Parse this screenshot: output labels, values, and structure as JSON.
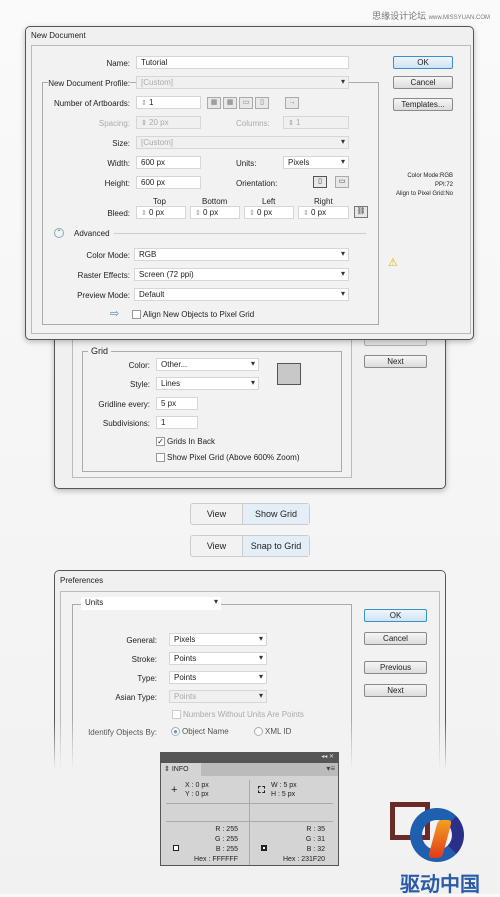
{
  "watermark": {
    "cn": "思缘设计论坛",
    "url": "www.MISSYUAN.COM"
  },
  "new_document": {
    "title": "New Document",
    "name_label": "Name:",
    "name_value": "Tutorial",
    "profile_label": "New Document Profile:",
    "profile_value": "[Custom]",
    "artboards_label": "Number of Artboards:",
    "artboards_value": "1",
    "spacing_label": "Spacing:",
    "spacing_value": "20 px",
    "columns_label": "Columns:",
    "columns_value": "1",
    "size_label": "Size:",
    "size_value": "[Custom]",
    "width_label": "Width:",
    "width_value": "600 px",
    "units_label": "Units:",
    "units_value": "Pixels",
    "height_label": "Height:",
    "height_value": "600 px",
    "orientation_label": "Orientation:",
    "bleed_label": "Bleed:",
    "bleed": [
      {
        "side": "Top",
        "value": "0 px"
      },
      {
        "side": "Bottom",
        "value": "0 px"
      },
      {
        "side": "Left",
        "value": "0 px"
      },
      {
        "side": "Right",
        "value": "0 px"
      }
    ],
    "advanced_label": "Advanced",
    "color_mode_label": "Color Mode:",
    "color_mode_value": "RGB",
    "raster_label": "Raster Effects:",
    "raster_value": "Screen (72 ppi)",
    "preview_label": "Preview Mode:",
    "preview_value": "Default",
    "align_label": "Align New Objects to Pixel Grid",
    "ok": "OK",
    "cancel": "Cancel",
    "templates": "Templates...",
    "summary": [
      "Color Mode:RGB",
      "PPI:72",
      "Align to Pixel Grid:No"
    ]
  },
  "grid_prefs": {
    "group": "Grid",
    "color_label": "Color:",
    "color_value": "Other...",
    "style_label": "Style:",
    "style_value": "Lines",
    "gridline_label": "Gridline every:",
    "gridline_value": "5 px",
    "subdiv_label": "Subdivisions:",
    "subdiv_value": "1",
    "grids_back": "Grids In Back",
    "grids_back_checked": true,
    "pixel_grid": "Show Pixel Grid (Above 600% Zoom)",
    "pixel_grid_checked": false,
    "next": "Next",
    "swatch_color": "#c8c8c8"
  },
  "menus": [
    {
      "menu": "View",
      "item": "Show Grid"
    },
    {
      "menu": "View",
      "item": "Snap to Grid"
    }
  ],
  "preferences": {
    "title": "Preferences",
    "section": "Units",
    "general_label": "General:",
    "general_value": "Pixels",
    "stroke_label": "Stroke:",
    "stroke_value": "Points",
    "type_label": "Type:",
    "type_value": "Points",
    "asian_label": "Asian Type:",
    "asian_value": "Points",
    "numbers_label": "Numbers Without Units Are Points",
    "identify_label": "Identify Objects By:",
    "identify_options": [
      "Object Name",
      "XML ID"
    ],
    "identify_selected": "Object Name",
    "ok": "OK",
    "cancel": "Cancel",
    "previous": "Previous",
    "next": "Next"
  },
  "info_panel": {
    "tab": "INFO",
    "x": "X  : 0 px",
    "y": "Y  : 0 px",
    "w": "W  : 5 px",
    "h": "H  : 5 px",
    "fill": {
      "r": "R : 255",
      "g": "G : 255",
      "b": "B : 255",
      "hex": "Hex : FFFFFF"
    },
    "stroke": {
      "r": "R : 35",
      "g": "G : 31",
      "b": "B : 32",
      "hex": "Hex : 231F20"
    }
  },
  "logo": {
    "text": "驱动中国"
  }
}
